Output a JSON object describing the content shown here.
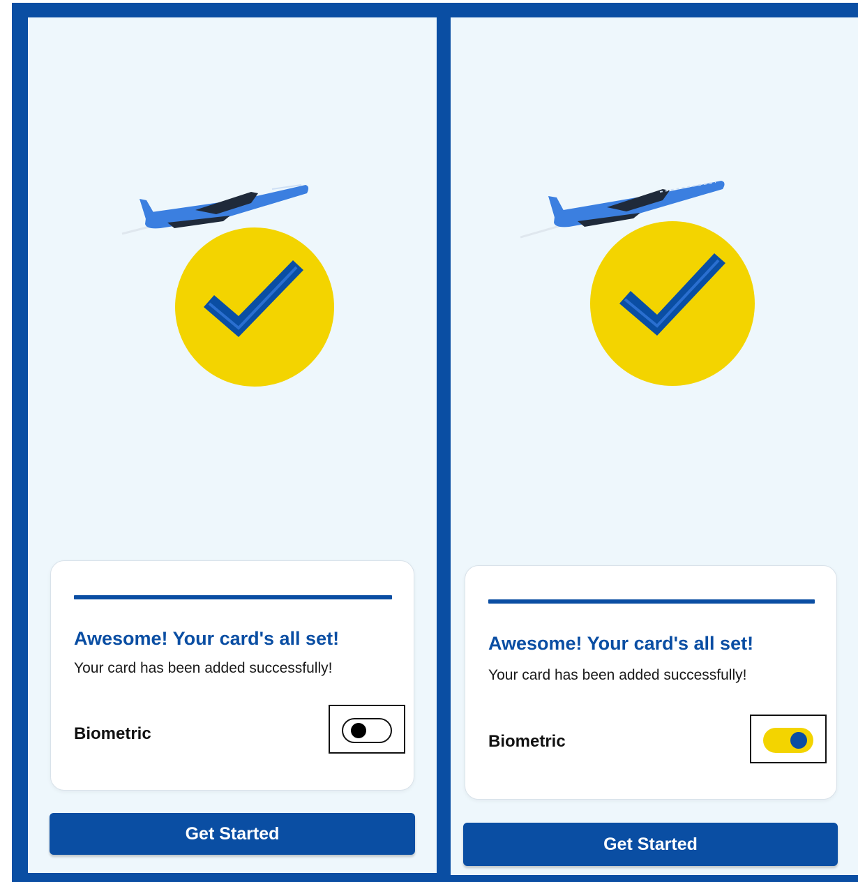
{
  "screens": [
    {
      "card": {
        "title": "Awesome! Your card's all set!",
        "subtitle": "Your card has been added successfully!",
        "biometric_label": "Biometric",
        "biometric_enabled": false
      },
      "button": {
        "label": "Get Started"
      },
      "illustration": {
        "icons": [
          "airplane-icon",
          "checkmark-badge-icon"
        ]
      }
    },
    {
      "card": {
        "title": "Awesome! Your card's all set!",
        "subtitle": "Your card has been added successfully!",
        "biometric_label": "Biometric",
        "biometric_enabled": true
      },
      "button": {
        "label": "Get Started"
      },
      "illustration": {
        "icons": [
          "airplane-icon",
          "checkmark-badge-icon"
        ]
      }
    }
  ],
  "colors": {
    "brand_blue": "#0a4ea3",
    "accent_yellow": "#f3d400",
    "background": "#eef7fc"
  }
}
